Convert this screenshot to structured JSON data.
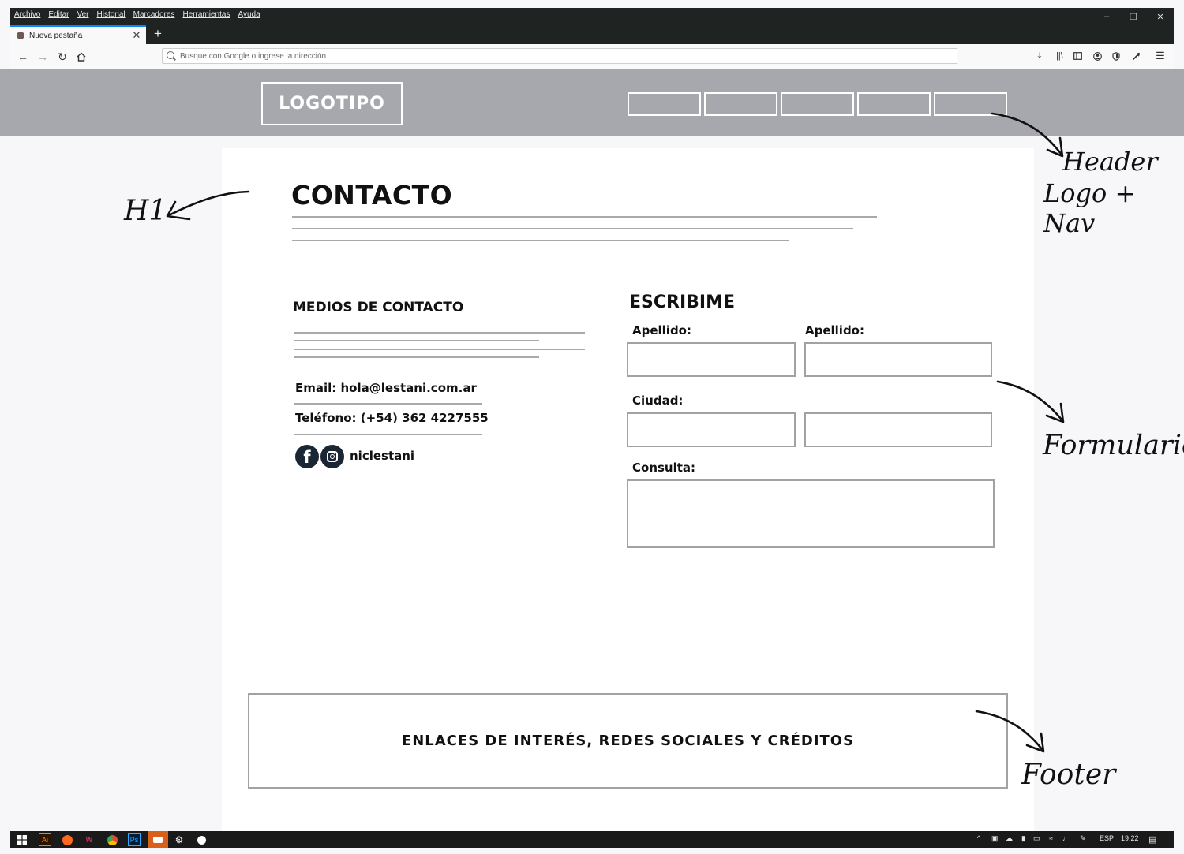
{
  "browser": {
    "menu": [
      "Archivo",
      "Editar",
      "Ver",
      "Historial",
      "Marcadores",
      "Herramientas",
      "Ayuda"
    ],
    "tab_title": "Nueva pestaña",
    "url_placeholder": "Busque con Google o ingrese la dirección"
  },
  "page": {
    "logo": "LOGOTIPO",
    "h1": "CONTACTO",
    "contact": {
      "title": "MEDIOS DE CONTACTO",
      "email": "Email: hola@lestani.com.ar",
      "phone": "Teléfono: (+54) 362 4227555",
      "social_handle": "niclestani"
    },
    "form": {
      "title": "ESCRIBIME",
      "label_1": "Apellido:",
      "label_2": "Apellido:",
      "label_3": "Ciudad:",
      "label_4": "Consulta:"
    },
    "footer": "ENLACES DE INTERÉS, REDES SOCIALES Y CRÉDITOS"
  },
  "annotations": {
    "h1": "H1",
    "header_1": "Header",
    "header_2": "Logo + Nav",
    "form": "Formulario",
    "footer": "Footer"
  },
  "taskbar": {
    "lang": "ESP",
    "time": "19:22"
  }
}
